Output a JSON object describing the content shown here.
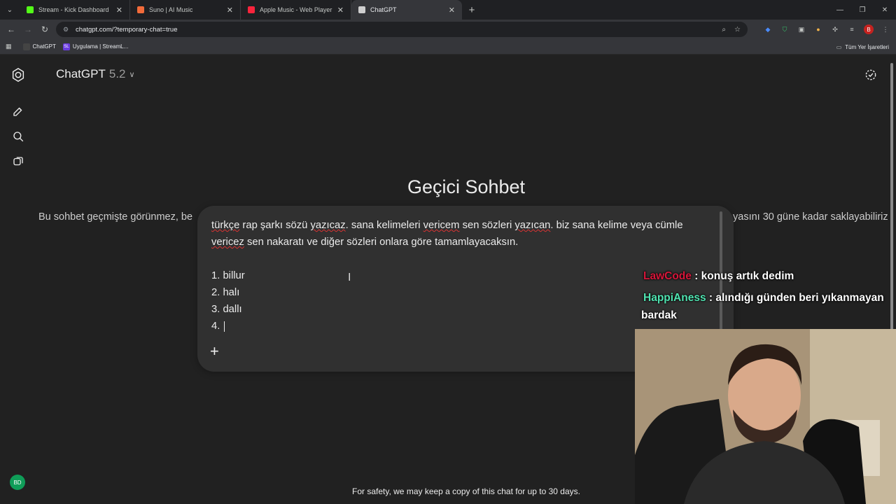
{
  "browser": {
    "tabs": [
      {
        "title": "Stream - Kick Dashboard",
        "favicon_color": "#53fc18",
        "active": false
      },
      {
        "title": "Suno | AI Music",
        "favicon_color": "#f26b3a",
        "active": false
      },
      {
        "title": "Apple Music - Web Player",
        "favicon_color": "#fa243c",
        "active": false
      },
      {
        "title": "ChatGPT",
        "favicon_color": "#cfcfcf",
        "active": true
      }
    ],
    "url": "chatgpt.com/?temporary-chat=true",
    "bookmarks": [
      {
        "label": "ChatGPT",
        "icon_color": "#444"
      },
      {
        "label": "Uygulama | StreamL...",
        "icon_color": "#6a3ce0",
        "icon_text": "SL"
      }
    ],
    "bookmarks_right": "Tüm Yer İşaretleri",
    "profile_letter": "B"
  },
  "app": {
    "model_name": "ChatGPT",
    "model_version": "5.2",
    "heading": "Geçici Sohbet",
    "subline_left": "Bu sohbet geçmişte görünmez, be",
    "subline_right": "yasını 30 güne kadar saklayabiliriz",
    "composer": {
      "paragraph_parts": [
        {
          "t": "türkçe",
          "sq": true
        },
        {
          "t": " rap şarkı sözü ",
          "sq": false
        },
        {
          "t": "yazıcaz",
          "sq": true
        },
        {
          "t": ". sana kelimeleri ",
          "sq": false
        },
        {
          "t": "vericem",
          "sq": true
        },
        {
          "t": " sen sözleri ",
          "sq": false
        },
        {
          "t": "yazıcan",
          "sq": true
        },
        {
          "t": ". biz sana kelime veya cümle ",
          "sq": false
        },
        {
          "t": "vericez",
          "sq": true
        },
        {
          "t": " sen nakaratı ve diğer sözleri onlara göre tamamlayacaksın.",
          "sq": false
        }
      ],
      "list": [
        "1. billur",
        "2. halı",
        "3. dallı",
        "4. "
      ]
    },
    "footer": "For safety, we may keep a copy of this chat for up to 30 days.",
    "avatar_initials": "BD"
  },
  "overlay_chat": [
    {
      "user": "LawCode",
      "user_color": "#d6163a",
      "message": ": konuş artık dedim"
    },
    {
      "user": "HappiAness",
      "user_color": "#4fe3b0",
      "message": ": alındığı günden beri yıkanmayan bardak"
    }
  ]
}
